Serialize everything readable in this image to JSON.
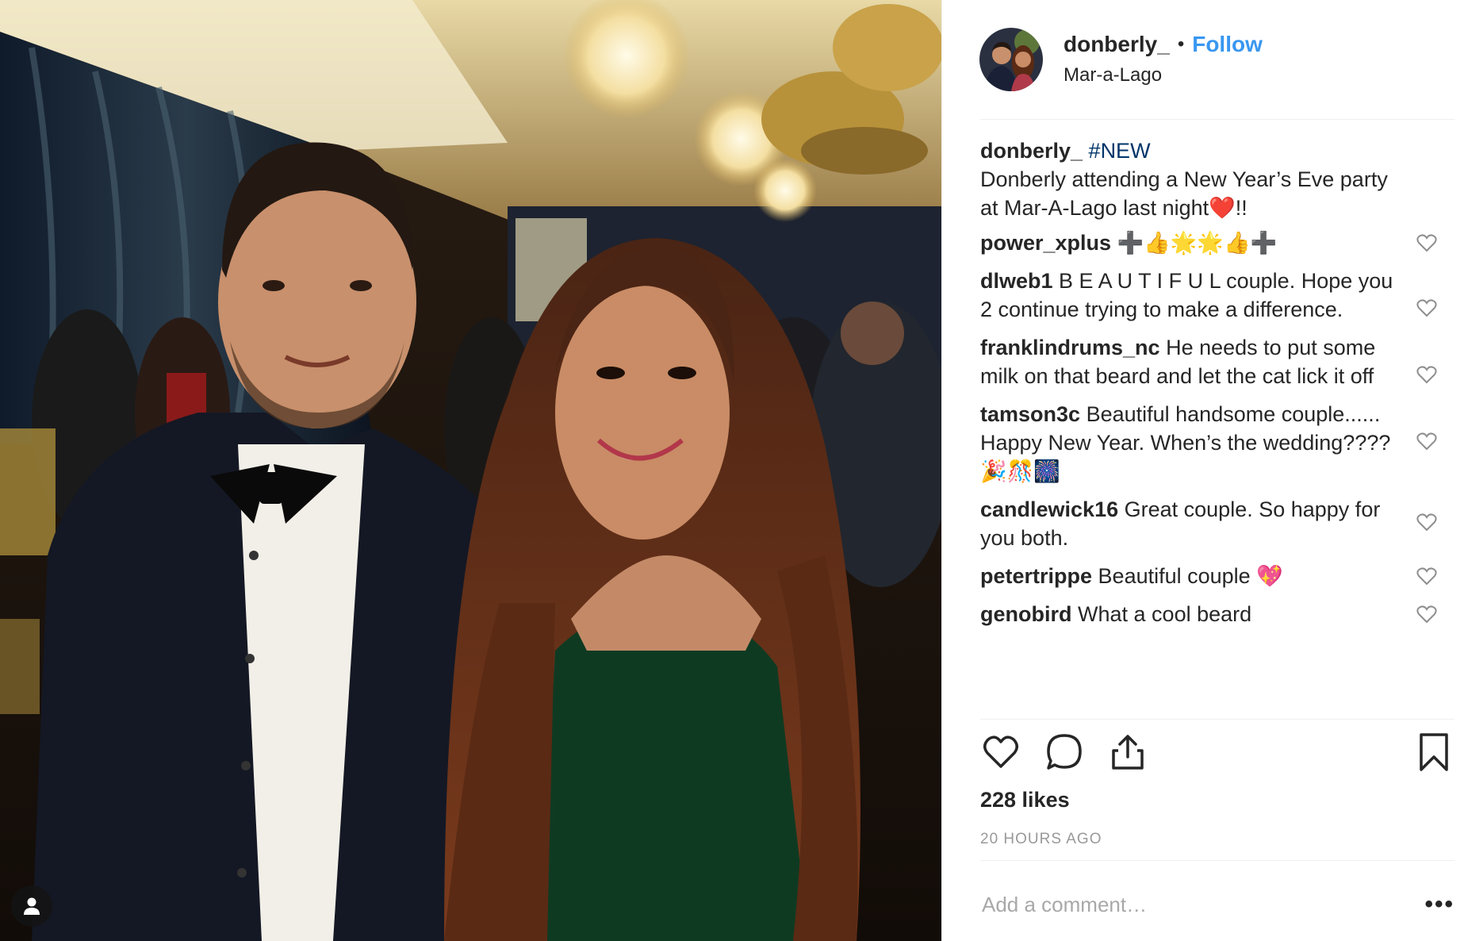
{
  "post": {
    "username": "donberly_",
    "separator": "•",
    "follow_label": "Follow",
    "location": "Mar-a-Lago"
  },
  "caption": {
    "username": "donberly_",
    "hashtag": "#NEW",
    "text": "Donberly attending a New Year’s Eve party at Mar-A-Lago last night❤️!!"
  },
  "comments": [
    {
      "user": "power_xplus",
      "text": "➕👍🌟🌟👍➕"
    },
    {
      "user": "dlweb1",
      "text": "B E A U T I F U L couple. Hope you 2 continue trying to make a difference."
    },
    {
      "user": "franklindrums_nc",
      "text": "He needs to put some milk on that beard and let the cat lick it off"
    },
    {
      "user": "tamson3c",
      "text": "Beautiful handsome couple...... Happy New Year. When’s the wedding???? 🎉🎊🎆"
    },
    {
      "user": "candlewick16",
      "text": "Great couple. So happy for you both."
    },
    {
      "user": "petertrippe",
      "text": "Beautiful couple 💖"
    },
    {
      "user": "genobird",
      "text": "What a cool beard"
    }
  ],
  "likes_label": "228 likes",
  "timestamp": "20 HOURS AGO",
  "comment_box": {
    "placeholder": "Add a comment…",
    "more_label": "•••"
  },
  "colors": {
    "link_blue": "#3897f0",
    "hashtag": "#003569",
    "muted": "#999999",
    "divider": "#efefef"
  },
  "icons": [
    "tag-user-icon",
    "heart-icon",
    "comment-icon",
    "share-icon",
    "bookmark-icon",
    "heart-outline-icon",
    "more-icon"
  ]
}
